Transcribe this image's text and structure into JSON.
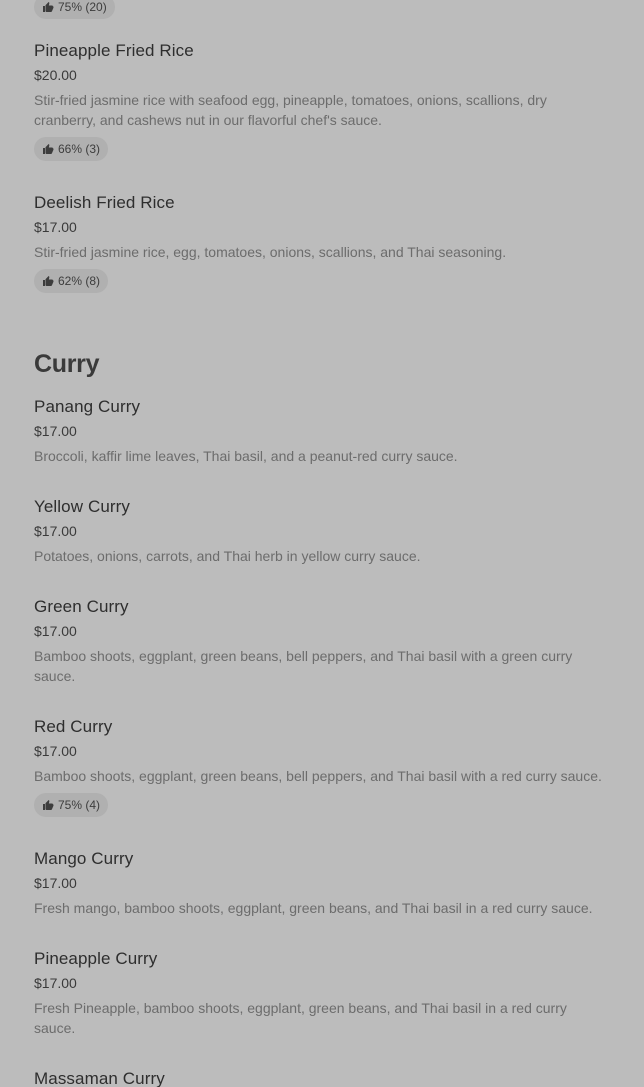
{
  "top_partial_badge": {
    "text": "75% (20)"
  },
  "items_rice": [
    {
      "name": "Pineapple Fried Rice",
      "price": "$20.00",
      "description": "Stir-fried jasmine rice with seafood egg, pineapple, tomatoes, onions, scallions, dry cranberry, and cashews nut in our flavorful chef's sauce.",
      "rating": "66% (3)"
    },
    {
      "name": "Deelish Fried Rice",
      "price": "$17.00",
      "description": "Stir-fried jasmine rice, egg, tomatoes, onions, scallions, and Thai seasoning.",
      "rating": "62% (8)"
    }
  ],
  "section_curry": {
    "title": "Curry"
  },
  "items_curry": [
    {
      "name": "Panang Curry",
      "price": "$17.00",
      "description": "Broccoli, kaffir lime leaves, Thai basil, and a peanut-red curry sauce."
    },
    {
      "name": "Yellow Curry",
      "price": "$17.00",
      "description": "Potatoes, onions, carrots, and Thai herb in yellow curry sauce."
    },
    {
      "name": "Green Curry",
      "price": "$17.00",
      "description": "Bamboo shoots, eggplant, green beans, bell peppers, and Thai basil with a green curry sauce."
    },
    {
      "name": "Red Curry",
      "price": "$17.00",
      "description": "Bamboo shoots, eggplant, green beans, bell peppers, and Thai basil with a red curry sauce.",
      "rating": "75% (4)"
    },
    {
      "name": "Mango Curry",
      "price": "$17.00",
      "description": "Fresh mango, bamboo shoots, eggplant, green beans, and Thai basil in a red curry sauce."
    },
    {
      "name": "Pineapple Curry",
      "price": "$17.00",
      "description": "Fresh Pineapple, bamboo shoots, eggplant, green beans, and Thai basil in a red curry sauce."
    },
    {
      "name": "Massaman Curry"
    }
  ],
  "icons": {
    "rating_icon": "thumbs-up-icon"
  }
}
